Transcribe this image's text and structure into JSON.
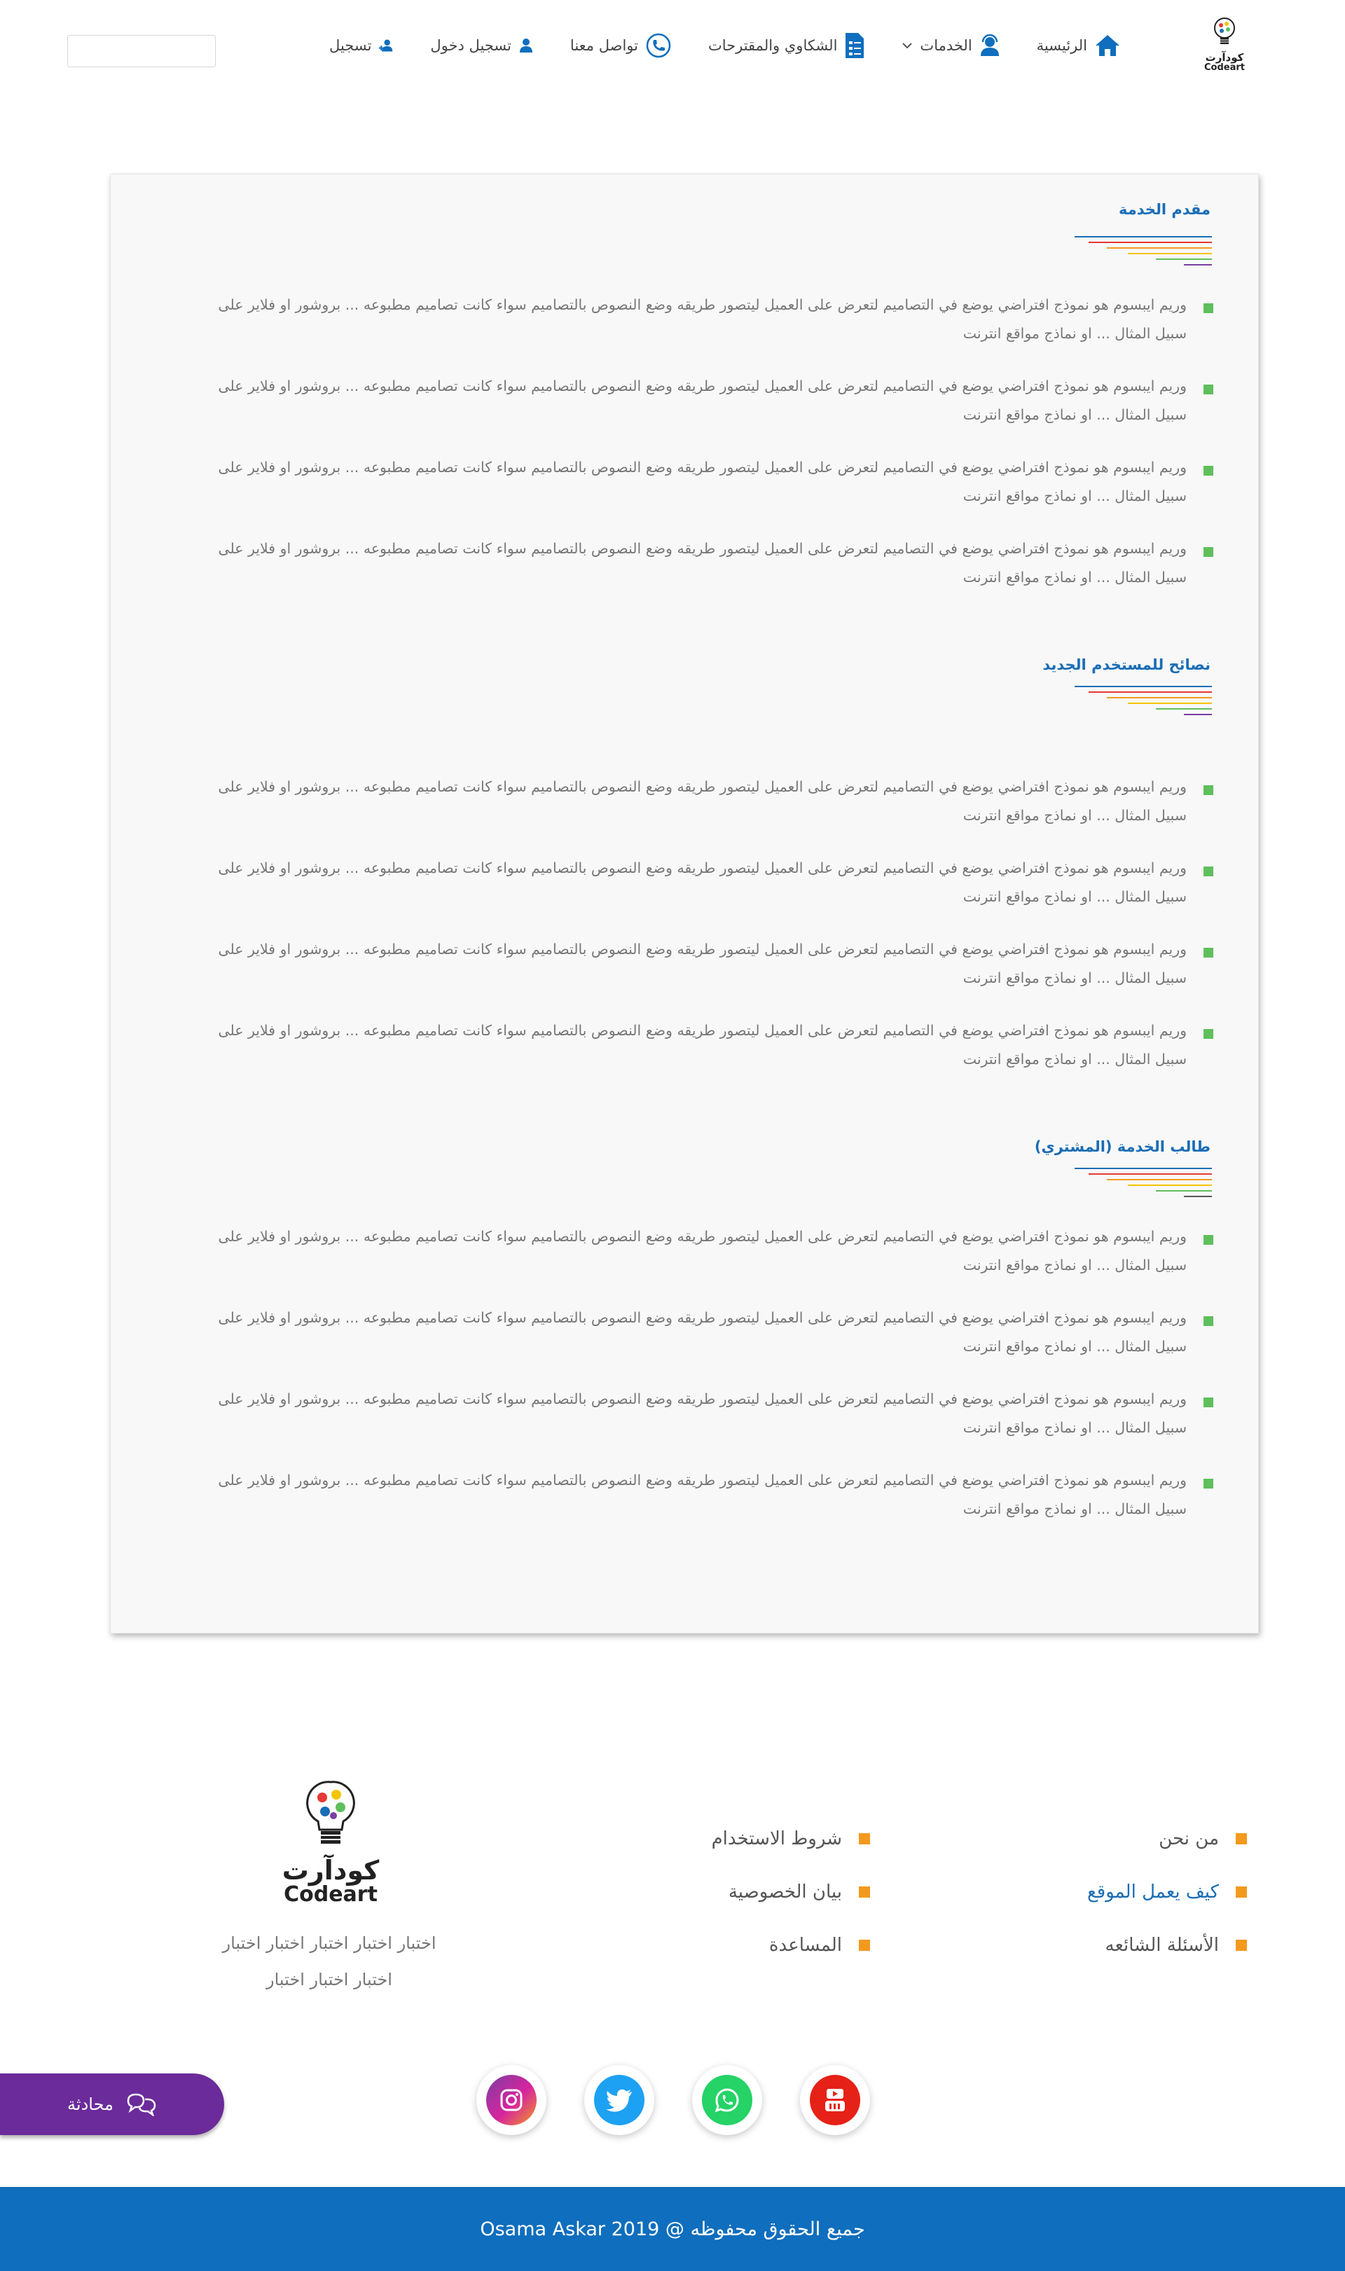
{
  "header": {
    "logo_ar": "كودآرت",
    "logo_en": "Codeart",
    "nav": [
      {
        "label": "الرئيسية",
        "icon": "home-icon"
      },
      {
        "label": "الخدمات",
        "icon": "support-agent-icon",
        "dropdown": true
      },
      {
        "label": "الشكاوي والمقترحات",
        "icon": "clipboard-icon"
      },
      {
        "label": "تواصل معنا",
        "icon": "phone-icon"
      },
      {
        "label": "تسجيل دخول",
        "icon": "user-icon"
      },
      {
        "label": "تسجيل",
        "icon": "user-add-icon"
      }
    ],
    "search": {
      "placeholder": "",
      "value": ""
    }
  },
  "sections": [
    {
      "title": "مقدم الخدمة",
      "items": [
        "وريم ايبسوم هو نموذج افتراضي يوضع في التصاميم لتعرض على العميل ليتصور طريقه وضع النصوص بالتصاميم سواء كانت تصاميم مطبوعه ... بروشور او فلاير على سبيل المثال ... او نماذج مواقع انترنت",
        "وريم ايبسوم هو نموذج افتراضي يوضع في التصاميم لتعرض على العميل ليتصور طريقه وضع النصوص بالتصاميم سواء كانت تصاميم مطبوعه ... بروشور او فلاير على سبيل المثال ... او نماذج مواقع انترنت",
        "وريم ايبسوم هو نموذج افتراضي يوضع في التصاميم لتعرض على العميل ليتصور طريقه وضع النصوص بالتصاميم سواء كانت تصاميم مطبوعه ... بروشور او فلاير على سبيل المثال ... او نماذج مواقع انترنت",
        "وريم ايبسوم هو نموذج افتراضي يوضع في التصاميم لتعرض على العميل ليتصور طريقه وضع النصوص بالتصاميم سواء كانت تصاميم مطبوعه ... بروشور او فلاير على سبيل المثال ... او نماذج مواقع انترنت"
      ]
    },
    {
      "title": "نصائح للمستخدم الجديد",
      "items": [
        "وريم ايبسوم هو نموذج افتراضي يوضع في التصاميم لتعرض على العميل ليتصور طريقه وضع النصوص بالتصاميم سواء كانت تصاميم مطبوعه ... بروشور او فلاير على سبيل المثال ... او نماذج مواقع انترنت",
        "وريم ايبسوم هو نموذج افتراضي يوضع في التصاميم لتعرض على العميل ليتصور طريقه وضع النصوص بالتصاميم سواء كانت تصاميم مطبوعه ... بروشور او فلاير على سبيل المثال ... او نماذج مواقع انترنت",
        "وريم ايبسوم هو نموذج افتراضي يوضع في التصاميم لتعرض على العميل ليتصور طريقه وضع النصوص بالتصاميم سواء كانت تصاميم مطبوعه ... بروشور او فلاير على سبيل المثال ... او نماذج مواقع انترنت",
        "وريم ايبسوم هو نموذج افتراضي يوضع في التصاميم لتعرض على العميل ليتصور طريقه وضع النصوص بالتصاميم سواء كانت تصاميم مطبوعه ... بروشور او فلاير على سبيل المثال ... او نماذج مواقع انترنت"
      ]
    },
    {
      "title": "طالب الخدمة (المشتري)",
      "items": [
        "وريم ايبسوم هو نموذج افتراضي يوضع في التصاميم لتعرض على العميل ليتصور طريقه وضع النصوص بالتصاميم سواء كانت تصاميم مطبوعه ... بروشور او فلاير على سبيل المثال ... او نماذج مواقع انترنت",
        "وريم ايبسوم هو نموذج افتراضي يوضع في التصاميم لتعرض على العميل ليتصور طريقه وضع النصوص بالتصاميم سواء كانت تصاميم مطبوعه ... بروشور او فلاير على سبيل المثال ... او نماذج مواقع انترنت",
        "وريم ايبسوم هو نموذج افتراضي يوضع في التصاميم لتعرض على العميل ليتصور طريقه وضع النصوص بالتصاميم سواء كانت تصاميم مطبوعه ... بروشور او فلاير على سبيل المثال ... او نماذج مواقع انترنت",
        "وريم ايبسوم هو نموذج افتراضي يوضع في التصاميم لتعرض على العميل ليتصور طريقه وضع النصوص بالتصاميم سواء كانت تصاميم مطبوعه ... بروشور او فلاير على سبيل المثال ... او نماذج مواقع انترنت"
      ]
    }
  ],
  "footer": {
    "links_col1": [
      "من نحن",
      "كيف يعمل الموقع",
      "الأسئلة الشائعه"
    ],
    "links_col2": [
      "شروط الاستخدام",
      "بيان الخصوصية",
      "المساعدة"
    ],
    "active_link": "كيف يعمل الموقع",
    "logo_ar": "كودآرت",
    "logo_en": "Codeart",
    "desc_line1": "اختبار اختبار اختبار اختبار اختبار",
    "desc_line2": "اختبار اختبار اختبار",
    "socials": [
      "youtube-icon",
      "whatsapp-icon",
      "twitter-icon",
      "instagram-icon"
    ],
    "chat_label": "محادثة",
    "copyright": "جميع الحقوق محفوظه @ 2019 Osama Askar"
  },
  "colors": {
    "brand_blue": "#0f6ebd",
    "title_blue": "#1a6db5",
    "bullet_green": "#5fbf5c",
    "footer_orange": "#f39a1e",
    "chat_purple": "#6b2b9a",
    "divider_lines": [
      "#1a6db5",
      "#e53935",
      "#f39a1e",
      "#f5c400",
      "#5fbf5c",
      "#7b3fa0"
    ]
  }
}
